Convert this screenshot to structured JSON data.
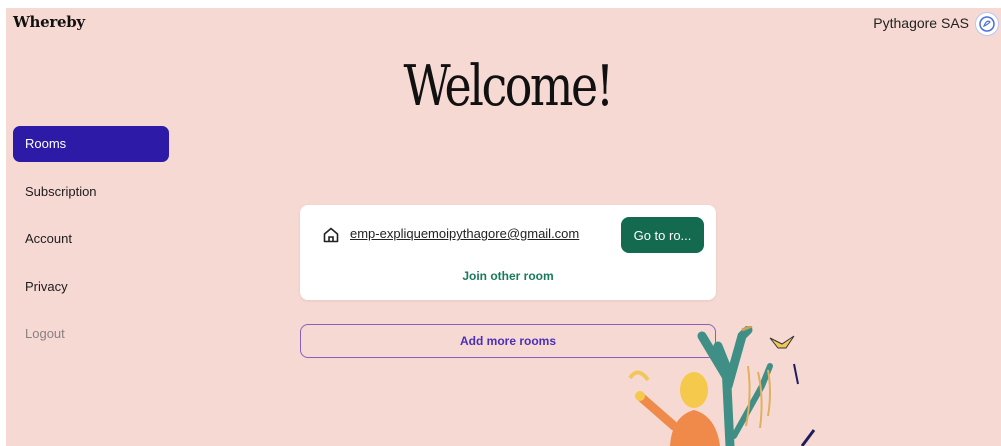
{
  "header": {
    "logo": "Whereby",
    "account_name": "Pythagore SAS"
  },
  "welcome": "Welcome!",
  "sidebar": {
    "items": [
      {
        "label": "Rooms",
        "active": true
      },
      {
        "label": "Subscription",
        "active": false
      },
      {
        "label": "Account",
        "active": false
      },
      {
        "label": "Privacy",
        "active": false
      },
      {
        "label": "Logout",
        "active": false
      }
    ]
  },
  "room_card": {
    "icon": "home-icon",
    "email": "emp-expliquemoipythagore@gmail.com",
    "go_button": "Go to ro...",
    "join_other": "Join other room"
  },
  "add_rooms_button": "Add more rooms",
  "colors": {
    "background": "#f7d9d4",
    "active_nav": "#2d1ba7",
    "go_button": "#136a4f",
    "join_link": "#1a7a5c",
    "add_rooms_text": "#4b2fb5"
  }
}
